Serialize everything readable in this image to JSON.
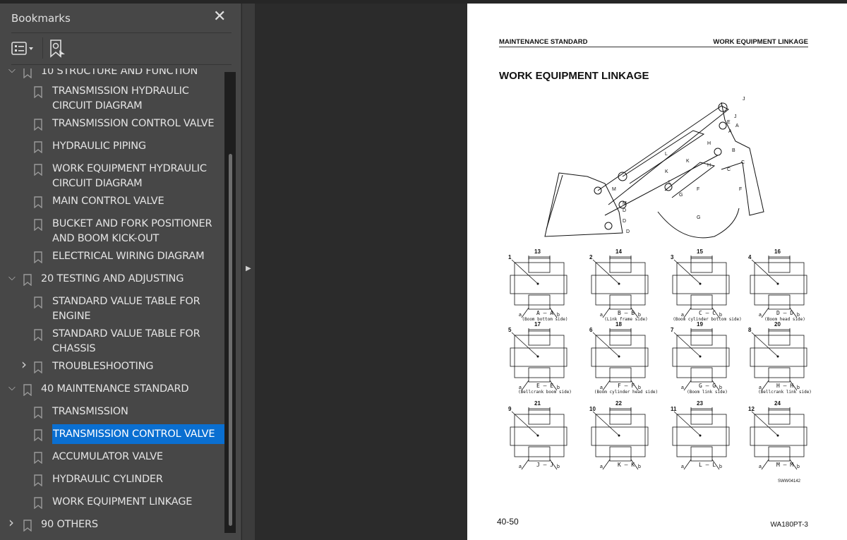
{
  "panel": {
    "title": "Bookmarks",
    "close": "✕"
  },
  "bookmarks": [
    {
      "label": "10 STRUCTURE AND FUNCTION",
      "level": 0,
      "expanded": true
    },
    {
      "label": "TRANSMISSION HYDRAULIC",
      "label2": "CIRCUIT DIAGRAM",
      "level": 1
    },
    {
      "label": "TRANSMISSION CONTROL VALVE",
      "level": 1
    },
    {
      "label": "HYDRAULIC PIPING",
      "level": 1
    },
    {
      "label": "WORK EQUIPMENT HYDRAULIC",
      "label2": "CIRCUIT DIAGRAM",
      "level": 1
    },
    {
      "label": "MAIN CONTROL VALVE",
      "level": 1
    },
    {
      "label": "BUCKET AND FORK POSITIONER",
      "label2": "AND BOOM KICK-OUT",
      "level": 1
    },
    {
      "label": "ELECTRICAL WIRING DIAGRAM",
      "level": 1
    },
    {
      "label": "20 TESTING AND ADJUSTING",
      "level": 0,
      "expanded": true
    },
    {
      "label": "STANDARD VALUE TABLE FOR",
      "label2": "ENGINE",
      "level": 1
    },
    {
      "label": "STANDARD VALUE TABLE FOR",
      "label2": "CHASSIS",
      "level": 1
    },
    {
      "label": "TROUBLESHOOTING",
      "level": 1,
      "collapsed": true
    },
    {
      "label": "40 MAINTENANCE STANDARD",
      "level": 0,
      "expanded": true
    },
    {
      "label": "TRANSMISSION",
      "level": 1
    },
    {
      "label": "TRANSMISSION CONTROL VALVE",
      "level": 1,
      "selected": true
    },
    {
      "label": "ACCUMULATOR VALVE",
      "level": 1
    },
    {
      "label": "HYDRAULIC CYLINDER",
      "level": 1
    },
    {
      "label": "WORK EQUIPMENT LINKAGE",
      "level": 1
    },
    {
      "label": "90 OTHERS",
      "level": 0,
      "collapsed": true
    }
  ],
  "selection_color": "#0a6fd1",
  "page": {
    "header_left": "MAINTENANCE STANDARD",
    "header_right": "WORK EQUIPMENT LINKAGE",
    "title": "WORK EQUIPMENT LINKAGE",
    "linkage_labels": [
      "J",
      "J",
      "E",
      "A",
      "A",
      "B",
      "C",
      "H",
      "H",
      "C",
      "K",
      "L",
      "K",
      "L",
      "G",
      "F",
      "F",
      "G",
      "M",
      "M",
      "D",
      "D",
      "D"
    ],
    "sections": [
      {
        "num": "1",
        "dim": "13",
        "sec": "A – A",
        "cap": "(Boom bottom side)"
      },
      {
        "num": "2",
        "dim": "14",
        "sec": "B – B",
        "cap": "(Link frame side)"
      },
      {
        "num": "3",
        "dim": "15",
        "sec": "C – C",
        "cap": "(Boom cylinder bottom side)"
      },
      {
        "num": "4",
        "dim": "16",
        "sec": "D – D",
        "cap": "(Boom head side)"
      },
      {
        "num": "5",
        "dim": "17",
        "sec": "E – E",
        "cap": "(Bellcrank boom side)"
      },
      {
        "num": "6",
        "dim": "18",
        "sec": "F – F",
        "cap": "(Boom cylinder head side)"
      },
      {
        "num": "7",
        "dim": "19",
        "sec": "G – G",
        "cap": "(Boom link side)"
      },
      {
        "num": "8",
        "dim": "20",
        "sec": "H – H",
        "cap": "(Bellcrank link side)"
      },
      {
        "num": "9",
        "dim": "21",
        "sec": "J – J",
        "cap": ""
      },
      {
        "num": "10",
        "dim": "22",
        "sec": "K – K",
        "cap": ""
      },
      {
        "num": "11",
        "dim": "23",
        "sec": "L – L",
        "cap": ""
      },
      {
        "num": "12",
        "dim": "24",
        "sec": "M – M",
        "cap": ""
      }
    ],
    "side_a": "a",
    "side_b": "b",
    "figure_code": "SWW04142",
    "page_number": "40-50",
    "model": "WA180PT-3"
  }
}
